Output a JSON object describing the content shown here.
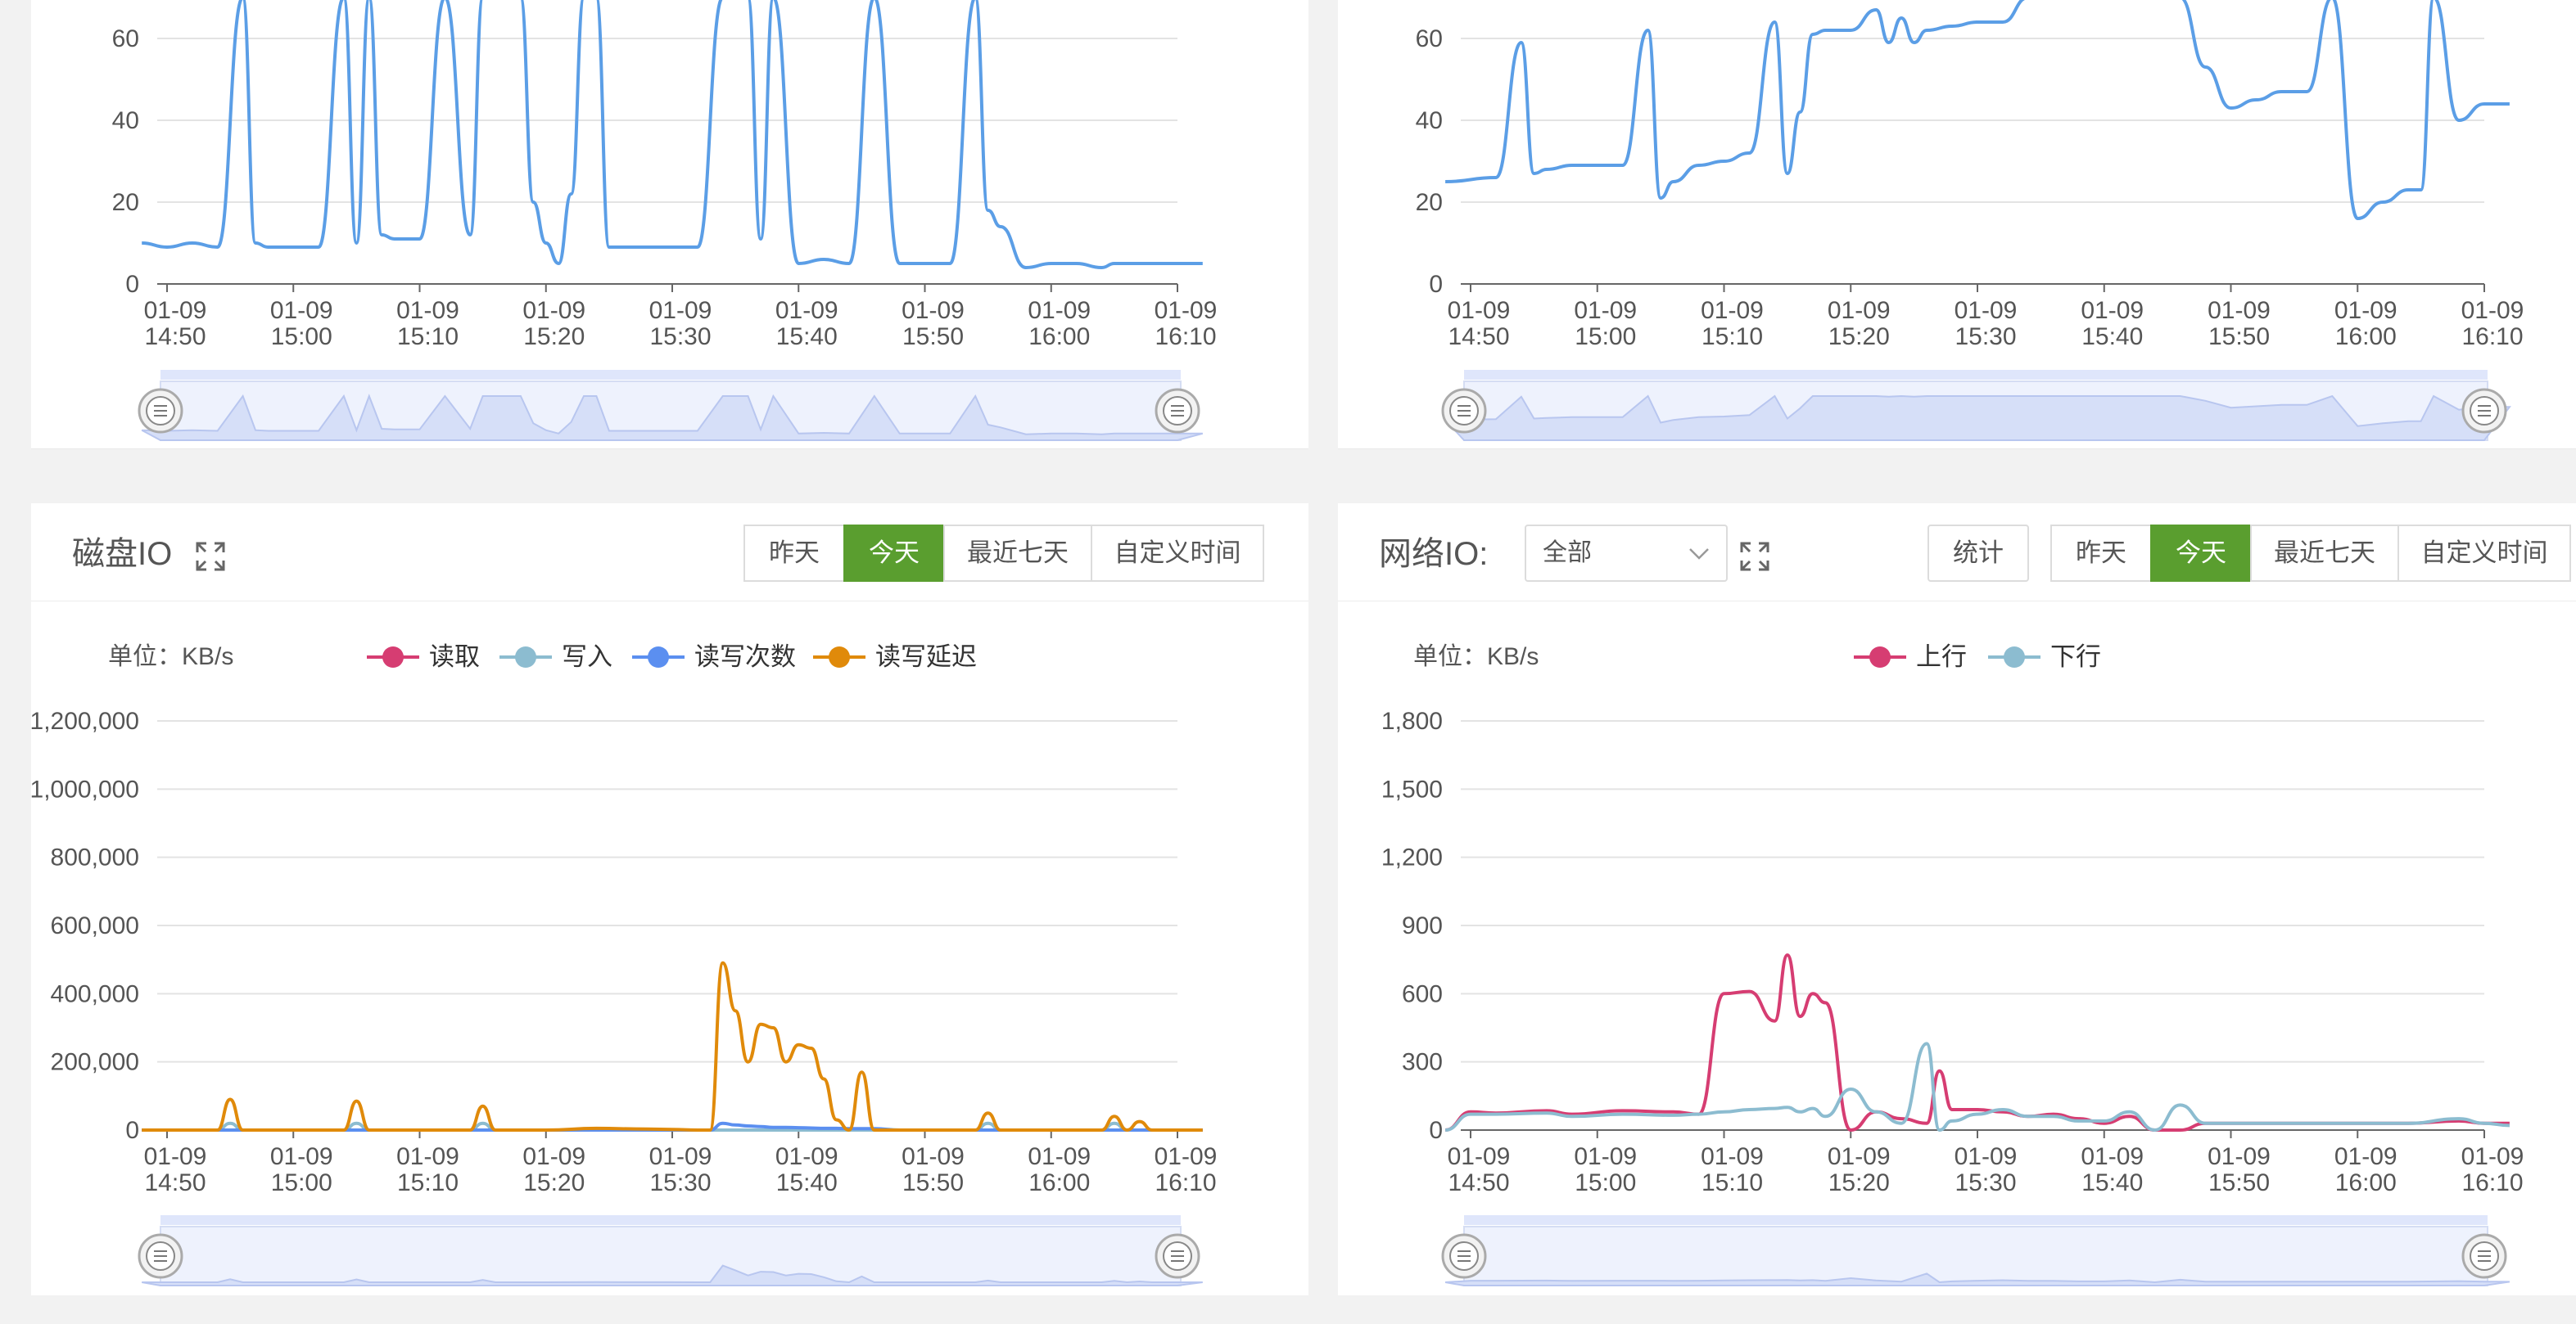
{
  "panels": {
    "cpu": {
      "y_ticks": [
        "0",
        "20",
        "40",
        "60"
      ],
      "x_ticks": [
        [
          "01-09",
          "14:50"
        ],
        [
          "01-09",
          "15:00"
        ],
        [
          "01-09",
          "15:10"
        ],
        [
          "01-09",
          "15:20"
        ],
        [
          "01-09",
          "15:30"
        ],
        [
          "01-09",
          "15:40"
        ],
        [
          "01-09",
          "15:50"
        ],
        [
          "01-09",
          "16:00"
        ],
        [
          "01-09",
          "16:10"
        ]
      ]
    },
    "memory": {
      "y_ticks": [
        "0",
        "20",
        "40",
        "60"
      ],
      "x_ticks": [
        [
          "01-09",
          "14:50"
        ],
        [
          "01-09",
          "15:00"
        ],
        [
          "01-09",
          "15:10"
        ],
        [
          "01-09",
          "15:20"
        ],
        [
          "01-09",
          "15:30"
        ],
        [
          "01-09",
          "15:40"
        ],
        [
          "01-09",
          "15:50"
        ],
        [
          "01-09",
          "16:00"
        ],
        [
          "01-09",
          "16:10"
        ]
      ]
    },
    "disk": {
      "title": "磁盘IO",
      "buttons": [
        "昨天",
        "今天",
        "最近七天",
        "自定义时间"
      ],
      "active_button": "今天",
      "unit": "单位：KB/s",
      "legend": [
        "读取",
        "写入",
        "读写次数",
        "读写延迟"
      ],
      "y_ticks": [
        "0",
        "200,000",
        "400,000",
        "600,000",
        "800,000",
        "1,000,000",
        "1,200,000"
      ],
      "x_ticks": [
        [
          "01-09",
          "14:50"
        ],
        [
          "01-09",
          "15:00"
        ],
        [
          "01-09",
          "15:10"
        ],
        [
          "01-09",
          "15:20"
        ],
        [
          "01-09",
          "15:30"
        ],
        [
          "01-09",
          "15:40"
        ],
        [
          "01-09",
          "15:50"
        ],
        [
          "01-09",
          "16:00"
        ],
        [
          "01-09",
          "16:10"
        ]
      ]
    },
    "network": {
      "title": "网络IO:",
      "select_value": "全部",
      "stats_button": "统计",
      "buttons": [
        "昨天",
        "今天",
        "最近七天",
        "自定义时间"
      ],
      "active_button": "今天",
      "unit": "单位：KB/s",
      "legend": [
        "上行",
        "下行"
      ],
      "y_ticks": [
        "0",
        "300",
        "600",
        "900",
        "1,200",
        "1,500",
        "1,800"
      ],
      "x_ticks": [
        [
          "01-09",
          "14:50"
        ],
        [
          "01-09",
          "15:00"
        ],
        [
          "01-09",
          "15:10"
        ],
        [
          "01-09",
          "15:20"
        ],
        [
          "01-09",
          "15:30"
        ],
        [
          "01-09",
          "15:40"
        ],
        [
          "01-09",
          "15:50"
        ],
        [
          "01-09",
          "16:00"
        ],
        [
          "01-09",
          "16:10"
        ]
      ]
    }
  },
  "colors": {
    "accent_green": "#5a9e2f",
    "line_blue": "#5b9ee6",
    "read_pink": "#d63d72",
    "write_lightblue": "#8cbcd0",
    "ops_blue": "#5b8ff0",
    "latency_orange": "#e08a0a",
    "slider_fill": "#dfe6fb"
  },
  "chart_data": [
    {
      "type": "line",
      "ylim": [
        0,
        60
      ],
      "x": [
        "14:48",
        "14:50",
        "14:52",
        "14:54",
        "14:56",
        "14:57",
        "14:58",
        "15:00",
        "15:02",
        "15:04",
        "15:05",
        "15:06",
        "15:07",
        "15:08",
        "15:10",
        "15:12",
        "15:14",
        "15:15",
        "15:16",
        "15:17",
        "15:18",
        "15:19",
        "15:20",
        "15:21",
        "15:22",
        "15:23",
        "15:24",
        "15:25",
        "15:26",
        "15:28",
        "15:30",
        "15:32",
        "15:34",
        "15:36",
        "15:37",
        "15:38",
        "15:40",
        "15:42",
        "15:44",
        "15:46",
        "15:48",
        "15:50",
        "15:52",
        "15:54",
        "15:55",
        "15:56",
        "15:58",
        "16:00",
        "16:02",
        "16:04",
        "16:05",
        "16:06",
        "16:07",
        "16:08",
        "16:10",
        "16:12"
      ],
      "series": [
        {
          "values": [
            10,
            9,
            10,
            9,
            70,
            10,
            9,
            9,
            9,
            70,
            10,
            70,
            12,
            11,
            11,
            70,
            12,
            70,
            70,
            70,
            70,
            20,
            10,
            5,
            22,
            70,
            70,
            9,
            9,
            9,
            9,
            9,
            70,
            70,
            11,
            70,
            5,
            6,
            5,
            70,
            5,
            5,
            5,
            70,
            18,
            14,
            4,
            5,
            5,
            4,
            5,
            5,
            5,
            5,
            5,
            5
          ]
        }
      ]
    },
    {
      "type": "line",
      "ylim": [
        0,
        60
      ],
      "x": [
        "14:48",
        "14:52",
        "14:54",
        "14:55",
        "14:56",
        "14:58",
        "15:02",
        "15:04",
        "15:05",
        "15:06",
        "15:08",
        "15:10",
        "15:12",
        "15:14",
        "15:15",
        "15:16",
        "15:17",
        "15:18",
        "15:20",
        "15:22",
        "15:23",
        "15:24",
        "15:25",
        "15:26",
        "15:28",
        "15:30",
        "15:32",
        "15:34",
        "15:35",
        "15:36",
        "15:38",
        "15:40",
        "15:42",
        "15:46",
        "15:48",
        "15:50",
        "15:52",
        "15:54",
        "15:56",
        "15:58",
        "16:00",
        "16:02",
        "16:04",
        "16:05",
        "16:06",
        "16:08",
        "16:10",
        "16:12"
      ],
      "series": [
        {
          "values": [
            25,
            26,
            59,
            27,
            28,
            29,
            29,
            62,
            21,
            25,
            29,
            30,
            32,
            64,
            27,
            42,
            61,
            62,
            62,
            67,
            59,
            65,
            59,
            62,
            63,
            64,
            64,
            70,
            70,
            70,
            70,
            70,
            70,
            70,
            53,
            43,
            45,
            47,
            47,
            70,
            16,
            20,
            23,
            23,
            70,
            40,
            44,
            44
          ]
        }
      ]
    },
    {
      "type": "line",
      "title": "磁盘IO",
      "ylabel": "单位：KB/s",
      "ylim": [
        0,
        1200000
      ],
      "x": [
        "14:48",
        "14:52",
        "14:54",
        "14:55",
        "14:56",
        "14:58",
        "15:02",
        "15:04",
        "15:05",
        "15:06",
        "15:08",
        "15:12",
        "15:14",
        "15:15",
        "15:16",
        "15:18",
        "15:20",
        "15:24",
        "15:28",
        "15:30",
        "15:32",
        "15:33",
        "15:34",
        "15:35",
        "15:36",
        "15:37",
        "15:38",
        "15:39",
        "15:40",
        "15:41",
        "15:42",
        "15:43",
        "15:44",
        "15:45",
        "15:46",
        "15:48",
        "15:52",
        "15:54",
        "15:55",
        "15:56",
        "15:58",
        "16:04",
        "16:05",
        "16:06",
        "16:07",
        "16:08",
        "16:10",
        "16:12"
      ],
      "series": [
        {
          "name": "读取",
          "values": [
            0,
            0,
            0,
            0,
            0,
            0,
            0,
            0,
            0,
            0,
            0,
            0,
            0,
            0,
            0,
            0,
            0,
            0,
            0,
            0,
            0,
            0,
            0,
            0,
            0,
            0,
            0,
            0,
            0,
            0,
            0,
            0,
            0,
            0,
            0,
            0,
            0,
            0,
            0,
            0,
            0,
            0,
            0,
            0,
            0,
            0,
            0,
            0
          ]
        },
        {
          "name": "写入",
          "values": [
            0,
            0,
            0,
            20000,
            0,
            0,
            0,
            0,
            20000,
            0,
            0,
            0,
            0,
            20000,
            0,
            0,
            0,
            0,
            0,
            0,
            0,
            0,
            0,
            0,
            0,
            0,
            0,
            0,
            0,
            0,
            0,
            0,
            0,
            0,
            0,
            0,
            0,
            0,
            20000,
            0,
            0,
            0,
            20000,
            0,
            0,
            0,
            0,
            0
          ]
        },
        {
          "name": "读写次数",
          "values": [
            0,
            0,
            0,
            0,
            0,
            0,
            0,
            0,
            0,
            0,
            0,
            0,
            0,
            0,
            0,
            0,
            0,
            0,
            0,
            0,
            0,
            0,
            20000,
            15000,
            12000,
            10000,
            8000,
            8000,
            7000,
            6000,
            5000,
            5000,
            4000,
            4000,
            4000,
            0,
            0,
            0,
            0,
            0,
            0,
            0,
            0,
            0,
            0,
            0,
            0,
            0
          ]
        },
        {
          "name": "读写延迟",
          "values": [
            0,
            0,
            0,
            90000,
            0,
            0,
            0,
            0,
            85000,
            0,
            0,
            0,
            0,
            70000,
            0,
            0,
            0,
            5000,
            3000,
            2000,
            0,
            0,
            490000,
            350000,
            200000,
            310000,
            300000,
            200000,
            250000,
            240000,
            150000,
            30000,
            0,
            170000,
            0,
            0,
            0,
            0,
            50000,
            0,
            0,
            0,
            40000,
            0,
            25000,
            0,
            0,
            0
          ]
        }
      ]
    },
    {
      "type": "line",
      "title": "网络IO:",
      "ylabel": "单位：KB/s",
      "ylim": [
        0,
        1800
      ],
      "x": [
        "14:48",
        "14:50",
        "14:52",
        "14:56",
        "14:58",
        "15:02",
        "15:06",
        "15:08",
        "15:10",
        "15:12",
        "15:14",
        "15:15",
        "15:16",
        "15:17",
        "15:18",
        "15:20",
        "15:22",
        "15:24",
        "15:26",
        "15:27",
        "15:28",
        "15:30",
        "15:32",
        "15:34",
        "15:36",
        "15:38",
        "15:40",
        "15:42",
        "15:44",
        "15:46",
        "15:48",
        "15:50",
        "15:52",
        "15:56",
        "16:00",
        "16:04",
        "16:08",
        "16:10",
        "16:12"
      ],
      "series": [
        {
          "name": "上行",
          "values": [
            0,
            80,
            75,
            85,
            70,
            85,
            80,
            70,
            600,
            610,
            480,
            770,
            500,
            600,
            560,
            0,
            80,
            50,
            30,
            260,
            90,
            90,
            80,
            60,
            70,
            50,
            30,
            60,
            0,
            0,
            30,
            30,
            30,
            30,
            30,
            30,
            40,
            30,
            30
          ]
        },
        {
          "name": "下行",
          "values": [
            0,
            70,
            70,
            75,
            60,
            70,
            65,
            70,
            80,
            90,
            95,
            100,
            80,
            95,
            60,
            180,
            80,
            30,
            380,
            0,
            40,
            70,
            90,
            60,
            60,
            40,
            40,
            80,
            0,
            110,
            30,
            30,
            30,
            30,
            30,
            30,
            50,
            30,
            20
          ]
        }
      ]
    }
  ]
}
